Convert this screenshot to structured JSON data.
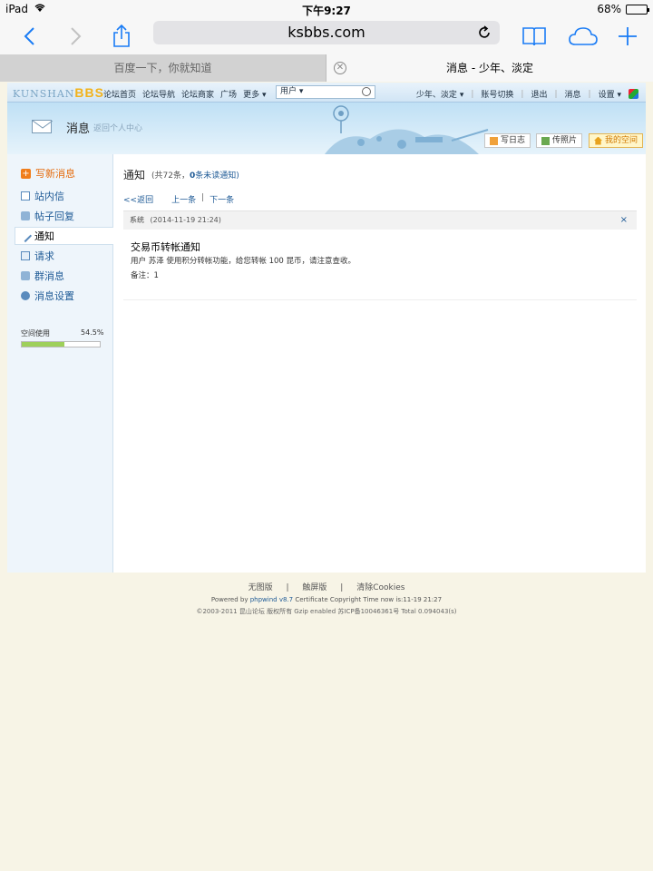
{
  "status": {
    "device": "iPad",
    "time": "下午9:27",
    "battery": "68%",
    "battery_level": 0.68
  },
  "browser": {
    "url": "ksbbs.com",
    "tabs": [
      {
        "label": "百度一下，你就知道"
      },
      {
        "label": "消息 - 少年、淡定"
      }
    ]
  },
  "forum_nav": {
    "logo_text": "KUNSHAN",
    "logo_bbs": "BBS",
    "links": [
      "论坛首页",
      "论坛导航",
      "论坛商家",
      "广场",
      "更多"
    ],
    "user_select": "用户",
    "right": [
      "少年、淡定",
      "账号切换",
      "退出",
      "消息",
      "设置"
    ]
  },
  "banner": {
    "title": "消息",
    "subtitle": "返回个人中心",
    "buttons": [
      "写日志",
      "传照片",
      "我的空间"
    ]
  },
  "sidebar": {
    "write": "写新消息",
    "items": [
      "站内信",
      "帖子回复",
      "通知",
      "请求",
      "群消息",
      "消息设置"
    ],
    "active_index": 2,
    "space_label": "空间使用",
    "space_pct": "54.5%",
    "space_value": 0.545
  },
  "main": {
    "title": "通知",
    "count_prefix": "(共72条，",
    "unread_num": "0",
    "unread_suffix": "条未读通知)",
    "back": "<<返回",
    "prev": "上一条",
    "sep": "|",
    "next": "下一条",
    "msg_sender": "系统",
    "msg_date": "(2014-11-19 21:24)",
    "close": "×",
    "msg_title": "交易币转帐通知",
    "msg_body": "用户 苏泽 使用积分转帐功能，给您转帐 100 昆币，请注意查收。",
    "msg_note": "备注：1"
  },
  "footer": {
    "links": [
      "无图版",
      "|",
      "触屏版",
      "|",
      "清除Cookies"
    ],
    "powered_prefix": "Powered by",
    "powered_name": "phpwind v8.7",
    "powered_suffix": "Certificate Copyright Time now is:11-19 21:27",
    "copyright": "©2003-2011 昆山论坛 版权所有 Gzip enabled 苏ICP备10046361号 Total 0.094043(s)"
  }
}
